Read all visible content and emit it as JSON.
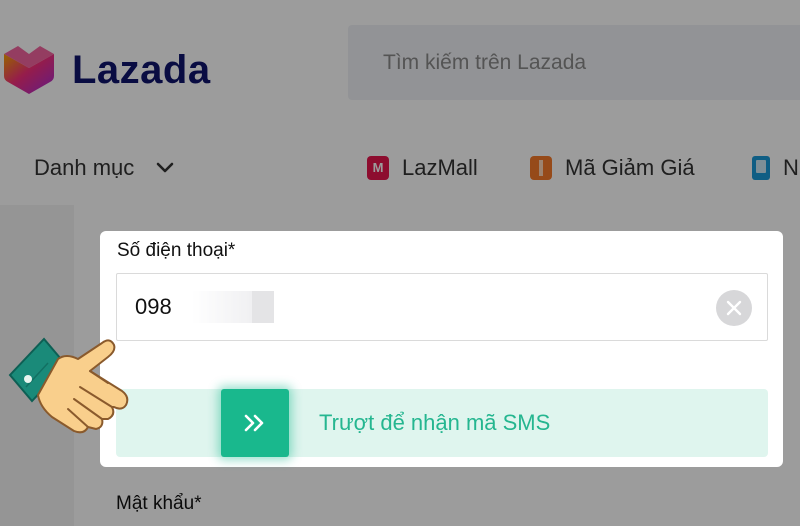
{
  "header": {
    "logo_text": "Lazada",
    "search": {
      "placeholder": "Tìm kiếm trên Lazada"
    }
  },
  "nav": {
    "category_label": "Danh mục",
    "links": [
      {
        "label": "LazMall",
        "icon": "lazmall-icon"
      },
      {
        "label": "Mã Giảm Giá",
        "icon": "voucher-icon"
      },
      {
        "label": "N",
        "icon": "phone-icon"
      }
    ]
  },
  "form": {
    "phone_label": "Số điện thoại*",
    "phone_value": "098",
    "slider_text": "Trượt để nhận mã SMS",
    "password_label": "Mật khẩu*"
  },
  "colors": {
    "brand_navy": "#0f146d",
    "accent_green": "#19b88d",
    "slider_bg": "#dff5ee",
    "overlay": "rgba(0,0,0,0.39)"
  }
}
